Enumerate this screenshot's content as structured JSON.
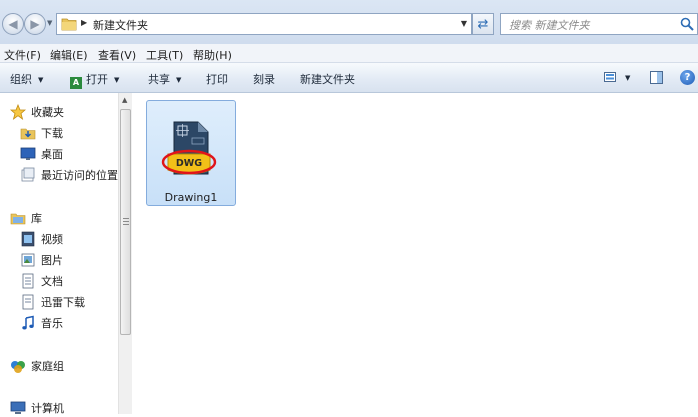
{
  "address_bar": {
    "path_text": "新建文件夹",
    "search_placeholder": "搜索 新建文件夹"
  },
  "menu_bar": {
    "items": [
      "文件(F)",
      "编辑(E)",
      "查看(V)",
      "工具(T)",
      "帮助(H)"
    ]
  },
  "command_bar": {
    "organize": "组织",
    "open": "打开",
    "share": "共享",
    "print": "打印",
    "burn": "刻录",
    "new_folder": "新建文件夹",
    "help_glyph": "?"
  },
  "navigation_pane": {
    "favorites": {
      "label": "收藏夹",
      "items": [
        "下载",
        "桌面",
        "最近访问的位置"
      ]
    },
    "libraries": {
      "label": "库",
      "items": [
        "视频",
        "图片",
        "文档",
        "迅雷下载",
        "音乐"
      ]
    },
    "homegroup": "家庭组",
    "computer": "计算机"
  },
  "content": {
    "files": [
      {
        "name": "Drawing1",
        "type_badge": "DWG"
      }
    ]
  },
  "colors": {
    "accent": "#2e6db5",
    "selection": "#cce4f7",
    "dwg_badge": "#f2c018",
    "highlight_ring": "#e0141a"
  }
}
